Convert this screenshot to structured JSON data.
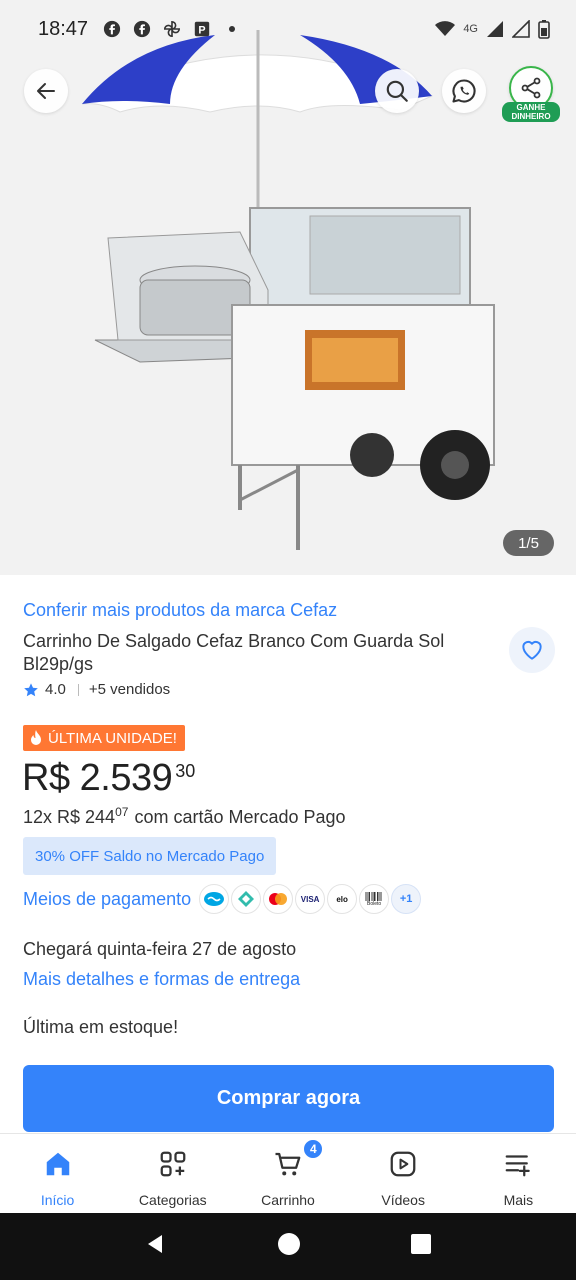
{
  "status_bar": {
    "time": "18:47",
    "notification_icons": [
      "facebook-icon",
      "facebook-icon",
      "pinwheel-icon",
      "parking-app-icon",
      "dot-icon"
    ],
    "network": "4G",
    "system_icons": [
      "wifi-icon",
      "signal-icon",
      "signal-alt-icon",
      "battery-icon"
    ]
  },
  "hero": {
    "image_counter": "1/5",
    "share_badge": "GANHE DINHEIRO"
  },
  "product": {
    "brand_link": "Conferir mais produtos da marca Cefaz",
    "title": "Carrinho De Salgado Cefaz Branco Com Guarda Sol Bl29p/gs",
    "rating": "4.0",
    "sold": "+5 vendidos",
    "badge": "ÚLTIMA UNIDADE!",
    "price_main": "R$ 2.539",
    "price_cents": "30",
    "installments_prefix": "12x R$ 244",
    "installments_cents": "07",
    "installments_suffix": "com cartão Mercado Pago",
    "off_chip": "30% OFF Saldo no Mercado Pago",
    "payment_label": "Meios de pagamento",
    "payment_icons": [
      "mercado-pago-icon",
      "pix-icon",
      "mastercard-icon",
      "visa-icon",
      "elo-icon",
      "boleto-icon"
    ],
    "payment_visa": "VISA",
    "payment_elo": "elo",
    "payment_boleto": "Boleto",
    "payment_more": "+1",
    "delivery_text": "Chegará quinta-feira 27 de agosto",
    "delivery_link": "Mais detalhes e formas de entrega",
    "stock_text": "Última em estoque!",
    "buy_button": "Comprar agora"
  },
  "bottom_nav": {
    "items": [
      {
        "label": "Início",
        "icon": "home-icon",
        "active": true
      },
      {
        "label": "Categorias",
        "icon": "categories-icon",
        "active": false
      },
      {
        "label": "Carrinho",
        "icon": "cart-icon",
        "active": false
      },
      {
        "label": "Vídeos",
        "icon": "video-icon",
        "active": false
      },
      {
        "label": "Mais",
        "icon": "menu-plus-icon",
        "active": false
      }
    ],
    "cart_count": "4"
  },
  "colors": {
    "accent": "#3483fa",
    "badge_orange": "#ff7733",
    "chip_bg": "#dbe8fb",
    "share_green": "#1f9d55"
  }
}
